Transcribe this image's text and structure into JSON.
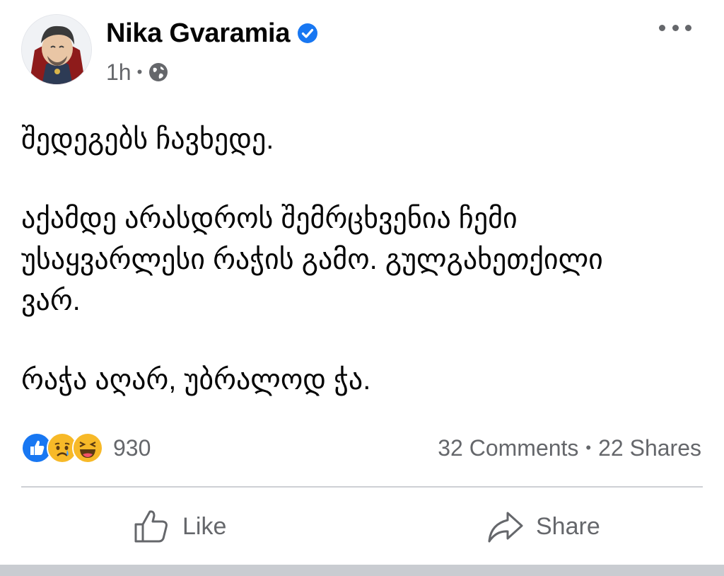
{
  "post": {
    "author": "Nika Gvaramia",
    "time": "1h",
    "separator": "•",
    "text": {
      "p1": "შედეგებს ჩავხედე.",
      "p2_line1": "აქამდე არასდროს შემრცხვენია ჩემი",
      "p2_line2": "უსაყვარლესი რაჭის გამო. გულგახეთქილი",
      "p2_line3": "ვარ.",
      "p3": "რაჭა აღარ, უბრალოდ ჭა."
    }
  },
  "icons": {
    "avatar": "profile-avatar",
    "verified": "verified-badge-icon",
    "audience": "globe-icon",
    "more": "more-options-icon",
    "reactions": [
      "like-reaction-icon",
      "sad-reaction-icon",
      "haha-reaction-icon"
    ],
    "like": "thumbs-up-icon",
    "share": "share-arrow-icon"
  },
  "engagement": {
    "reactions_count": "930",
    "comments": "32 Comments",
    "separator": "•",
    "shares": "22 Shares"
  },
  "actions": {
    "like_label": "Like",
    "share_label": "Share"
  },
  "colors": {
    "verified": "#1877f2",
    "text_secondary": "#65676b",
    "like_blue": "#1877f2",
    "emoji_yellow": "#f7b928"
  }
}
